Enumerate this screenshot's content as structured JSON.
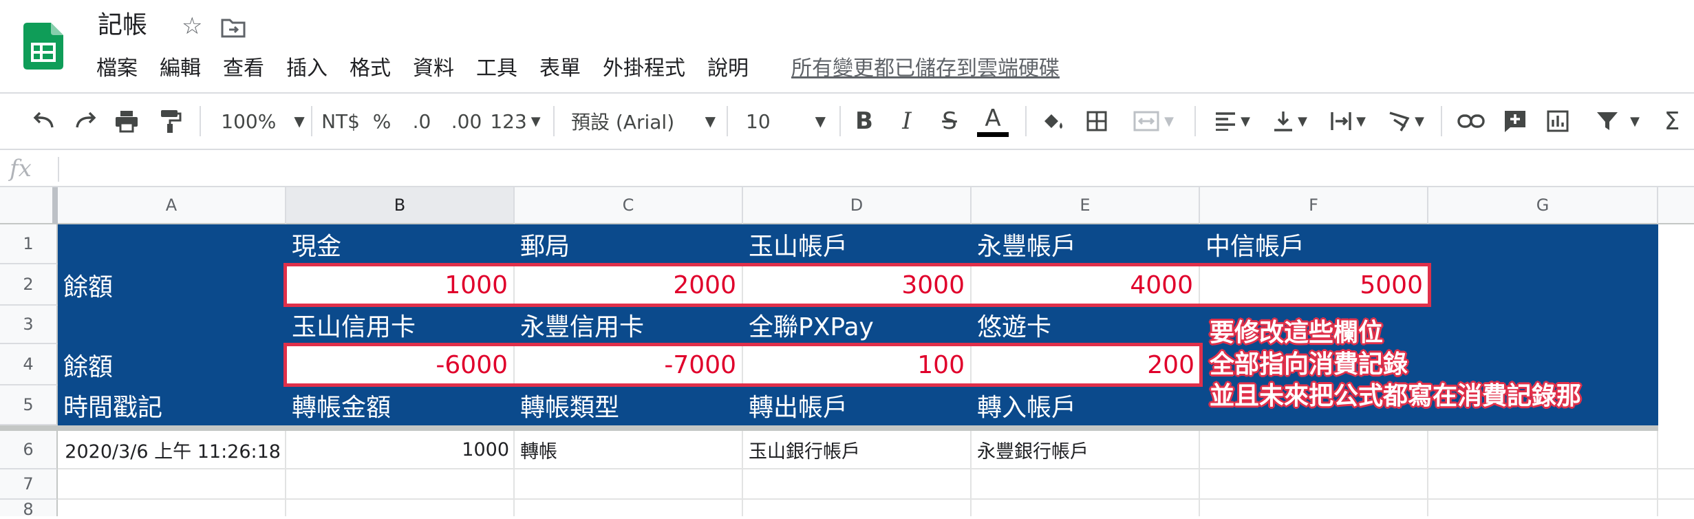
{
  "header": {
    "doc_title": "記帳",
    "save_status": "所有變更都已儲存到雲端硬碟",
    "menu": [
      "檔案",
      "編輯",
      "查看",
      "插入",
      "格式",
      "資料",
      "工具",
      "表單",
      "外掛程式",
      "說明"
    ]
  },
  "toolbar": {
    "zoom": "100%",
    "currency": "NT$",
    "percent": "%",
    "decrease_decimal": ".0",
    "increase_decimal": ".00",
    "number_format": "123",
    "font": "預設 (Arial)",
    "font_size": "10",
    "bold": "B",
    "italic": "I",
    "strike": "S",
    "text_color": "A",
    "sum": "Σ"
  },
  "formula_bar": {
    "fx": "fx",
    "value": ""
  },
  "grid": {
    "columns": [
      "A",
      "B",
      "C",
      "D",
      "E",
      "F",
      "G"
    ],
    "rows": [
      "1",
      "2",
      "3",
      "4",
      "5",
      "6",
      "7",
      "8"
    ],
    "row1": {
      "B": "現金",
      "C": "郵局",
      "D": "玉山帳戶",
      "E": "永豐帳戶",
      "F": "中信帳戶"
    },
    "row2": {
      "A": "餘額",
      "B": "1000",
      "C": "2000",
      "D": "3000",
      "E": "4000",
      "F": "5000"
    },
    "row3": {
      "B": "玉山信用卡",
      "C": "永豐信用卡",
      "D": "全聯PXPay",
      "E": "悠遊卡"
    },
    "row4": {
      "A": "餘額",
      "B": "-6000",
      "C": "-7000",
      "D": "100",
      "E": "200"
    },
    "row5": {
      "A": "時間戳記",
      "B": "轉帳金額",
      "C": "轉帳類型",
      "D": "轉出帳戶",
      "E": "轉入帳戶"
    },
    "row6": {
      "A": "2020/3/6 上午 11:26:18",
      "B": "1000",
      "C": "轉帳",
      "D": "玉山銀行帳戶",
      "E": "永豐銀行帳戶"
    }
  },
  "annotation": [
    "要修改這些欄位",
    "全部指向消費記錄",
    "並且未來把公式都寫在消費記錄那"
  ],
  "colors": {
    "band": "#0b4a8c",
    "highlight": "#e0304a",
    "negative_text": "#e0002b",
    "brand_green": "#188038"
  }
}
